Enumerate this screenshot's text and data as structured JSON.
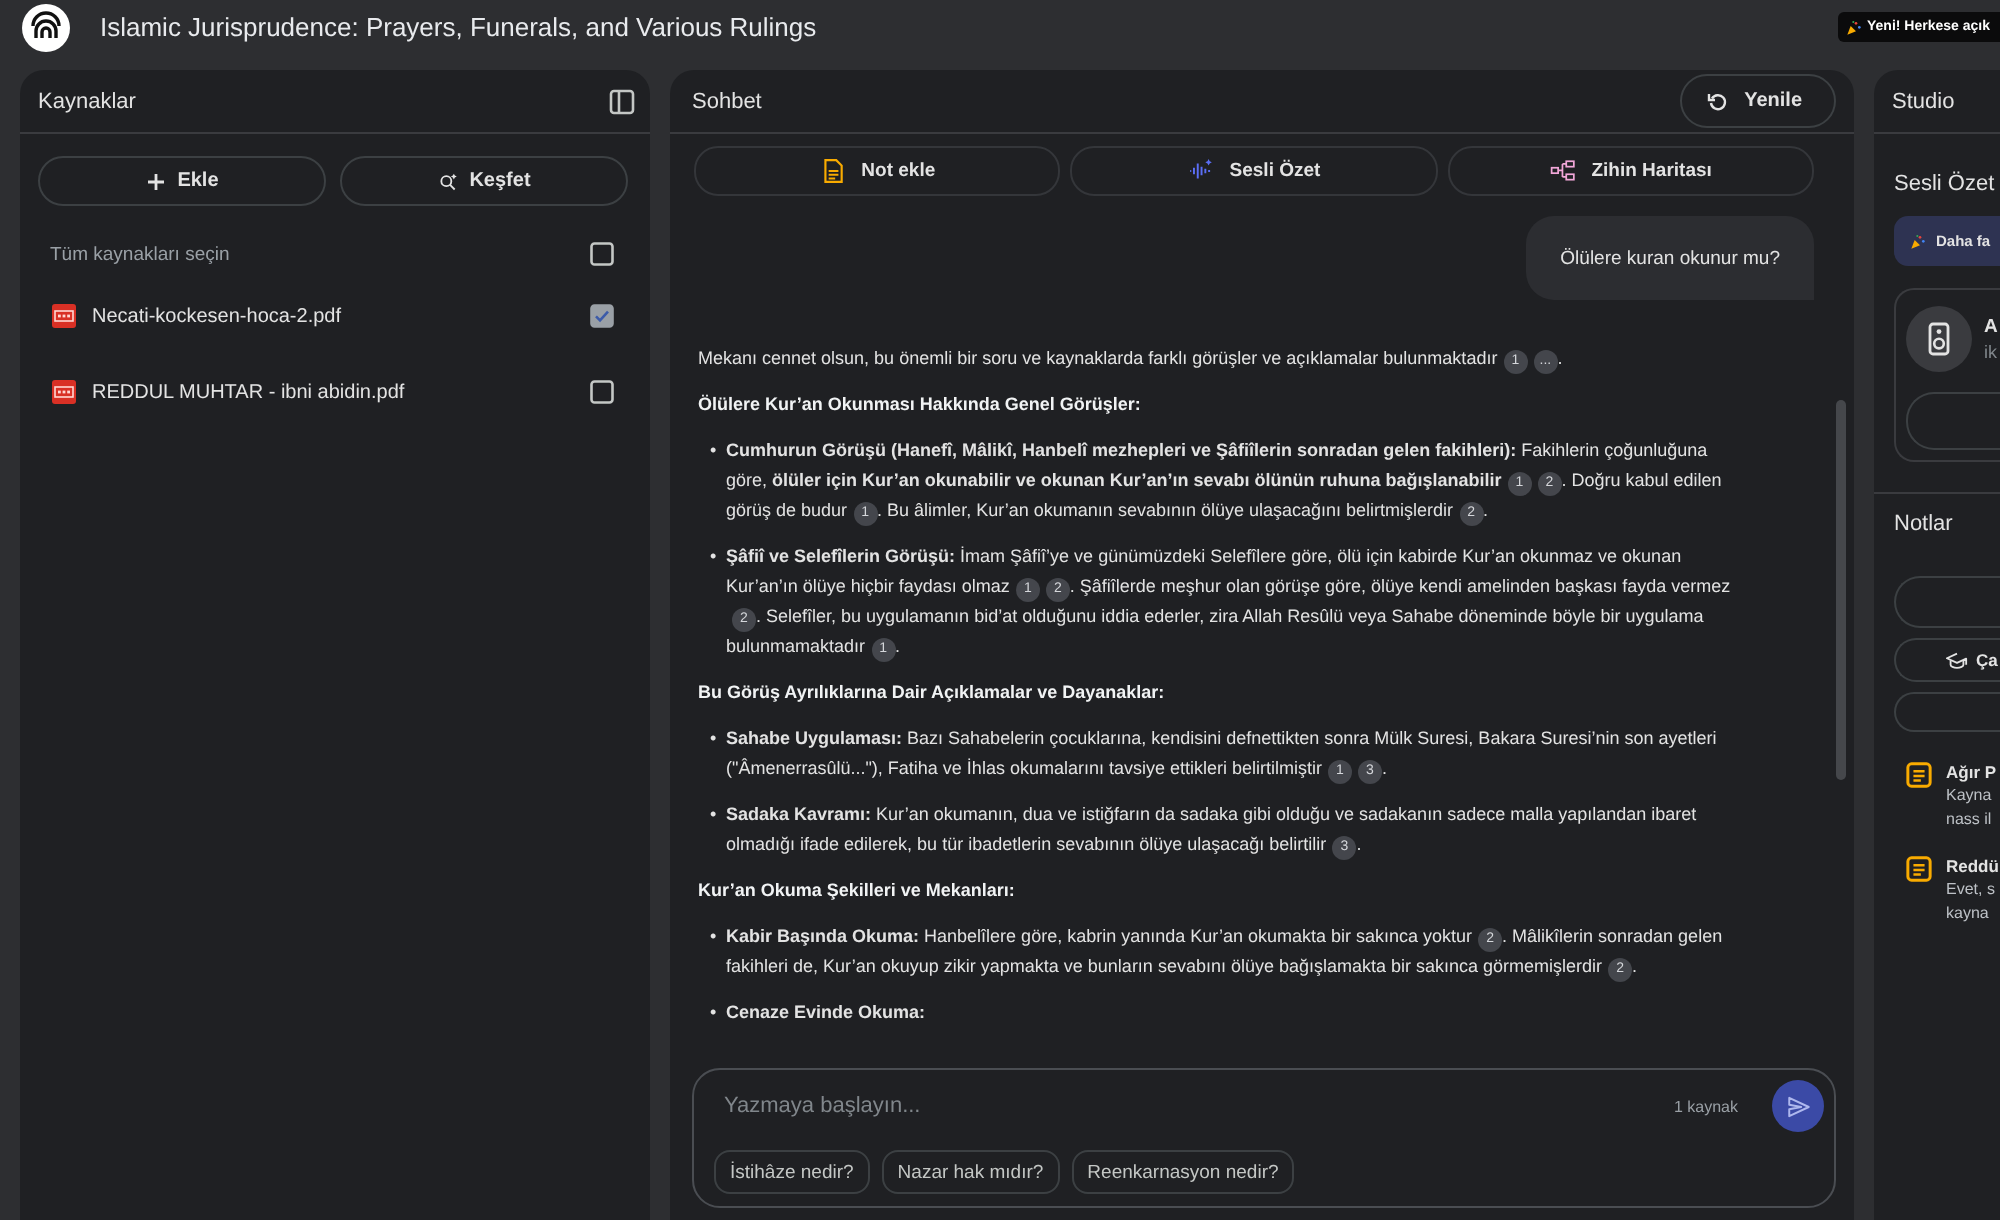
{
  "header": {
    "title": "Islamic Jurisprudence: Prayers, Funerals, and Various Rulings",
    "badge": "Yeni! Herkese açık"
  },
  "sources": {
    "title": "Kaynaklar",
    "buttons": [
      {
        "kind": "add",
        "label": "Ekle"
      },
      {
        "kind": "discover",
        "label": "Keşfet"
      }
    ],
    "select_all": {
      "label": "Tüm kaynakları seçin",
      "checked": false
    },
    "items": [
      {
        "name": "Necati-kockesen-hoca-2.pdf",
        "checked": true
      },
      {
        "name": "REDDUL MUHTAR - ibni abidin.pdf",
        "checked": false
      }
    ]
  },
  "chat": {
    "title": "Sohbet",
    "refresh_button": "Yenile",
    "actions": [
      {
        "kind": "note",
        "label": "Not ekle"
      },
      {
        "kind": "audio",
        "label": "Sesli Özet"
      },
      {
        "kind": "mindmap",
        "label": "Zihin Haritası"
      }
    ],
    "user_message": "Ölülere kuran okunur mu?",
    "answer": [
      {
        "kind": "paragraph",
        "parts": [
          {
            "kind": "text",
            "text": "Mekanı cennet olsun, bu önemli bir soru ve kaynaklarda farklı görüşler ve açıklamalar bulunmaktadır"
          },
          {
            "kind": "cite",
            "text": "1"
          },
          {
            "kind": "cite",
            "text": "..."
          },
          {
            "kind": "text",
            "text": "."
          }
        ]
      },
      {
        "kind": "heading",
        "text": "Ölülere Kur’an Okunması Hakkında Genel Görüşler:"
      },
      {
        "kind": "bullet",
        "marker": "•",
        "parts": [
          {
            "kind": "text",
            "text": "**Cumhurun Görüşü (Hanefî, Mâlikî, Hanbelî mezhepleri ve Şâfiîlerin sonradan gelen fakihleri):** Fakihlerin çoğunluğuna göre, **ölüler için Kur’an okunabilir ve okunan Kur’an’ın sevabı ölünün ruhuna bağışlanabilir**"
          },
          {
            "kind": "cite",
            "text": "1"
          },
          {
            "kind": "cite",
            "text": "2"
          },
          {
            "kind": "text",
            "text": ". Doğru kabul edilen görüş de budur"
          },
          {
            "kind": "cite",
            "text": "1"
          },
          {
            "kind": "text",
            "text": ". Bu âlimler, Kur’an okumanın sevabının ölüye ulaşacağını belirtmişlerdir"
          },
          {
            "kind": "cite",
            "text": "2"
          },
          {
            "kind": "text",
            "text": "."
          }
        ]
      },
      {
        "kind": "bullet",
        "marker": "•",
        "parts": [
          {
            "kind": "text",
            "text": "**Şâfiî ve Selefîlerin Görüşü:** İmam Şâfiî’ye ve günümüzdeki Selefîlere göre, ölü için kabirde Kur’an okunmaz ve okunan Kur’an’ın ölüye hiçbir faydası olmaz"
          },
          {
            "kind": "cite",
            "text": "1"
          },
          {
            "kind": "cite",
            "text": "2"
          },
          {
            "kind": "text",
            "text": ". Şâfiîlerde meşhur olan görüşe göre, ölüye kendi amelinden başkası fayda vermez"
          },
          {
            "kind": "cite",
            "text": "2"
          },
          {
            "kind": "text",
            "text": ". Selefîler, bu uygulamanın bid’at olduğunu iddia ederler, zira Allah Resûlü veya Sahabe döneminde böyle bir uygulama bulunmamaktadır"
          },
          {
            "kind": "cite",
            "text": "1"
          },
          {
            "kind": "text",
            "text": "."
          }
        ]
      },
      {
        "kind": "heading",
        "text": "Bu Görüş Ayrılıklarına Dair Açıklamalar ve Dayanaklar:"
      },
      {
        "kind": "bullet",
        "marker": "•",
        "parts": [
          {
            "kind": "text",
            "text": "**Sahabe Uygulaması:** Bazı Sahabelerin çocuklarına, kendisini defnettikten sonra Mülk Suresi, Bakara Suresi’nin son ayetleri (\"Âmenerrasûlü...\"), Fatiha ve İhlas okumalarını tavsiye ettikleri belirtilmiştir"
          },
          {
            "kind": "cite",
            "text": "1"
          },
          {
            "kind": "cite",
            "text": "3"
          },
          {
            "kind": "text",
            "text": "."
          }
        ]
      },
      {
        "kind": "bullet",
        "marker": "•",
        "parts": [
          {
            "kind": "text",
            "text": "**Sadaka Kavramı:** Kur’an okumanın, dua ve istiğfarın da sadaka gibi olduğu ve sadakanın sadece malla yapılandan ibaret olmadığı ifade edilerek, bu tür ibadetlerin sevabının ölüye ulaşacağı belirtilir"
          },
          {
            "kind": "cite",
            "text": "3"
          },
          {
            "kind": "text",
            "text": "."
          }
        ]
      },
      {
        "kind": "heading",
        "text": "Kur’an Okuma Şekilleri ve Mekanları:"
      },
      {
        "kind": "bullet",
        "marker": "•",
        "parts": [
          {
            "kind": "text",
            "text": "**Kabir Başında Okuma:** Hanbelîlere göre, kabrin yanında Kur’an okumakta bir sakınca yoktur"
          },
          {
            "kind": "cite",
            "text": "2"
          },
          {
            "kind": "text",
            "text": ". Mâlikîlerin sonradan gelen fakihleri de, Kur’an okuyup zikir yapmakta ve bunların sevabını ölüye bağışlamakta bir sakınca görmemişlerdir"
          },
          {
            "kind": "cite",
            "text": "2"
          },
          {
            "kind": "text",
            "text": "."
          }
        ]
      },
      {
        "kind": "bullet",
        "marker": "•",
        "parts": [
          {
            "kind": "text",
            "text": "**Cenaze Evinde Okuma:**"
          }
        ]
      }
    ],
    "composer": {
      "placeholder": "Yazmaya başlayın...",
      "source_count": "1 kaynak",
      "suggestions": [
        "İstihâze nedir?",
        "Nazar hak mıdır?",
        "Reenkarnasyon nedir?"
      ]
    }
  },
  "studio": {
    "title": "Studio",
    "audio_title": "Sesli Özet",
    "banner": "Daha fa",
    "audio_card": {
      "title": "A",
      "subtitle": "ik"
    },
    "notes_title": "Notlar",
    "study_button": "Ça",
    "notes": [
      {
        "title": "Ağır P",
        "snippet_lines": [
          "Kayna",
          "nass il"
        ]
      },
      {
        "title": "Reddü",
        "snippet_lines": [
          "Evet, s",
          "kayna"
        ]
      }
    ]
  }
}
